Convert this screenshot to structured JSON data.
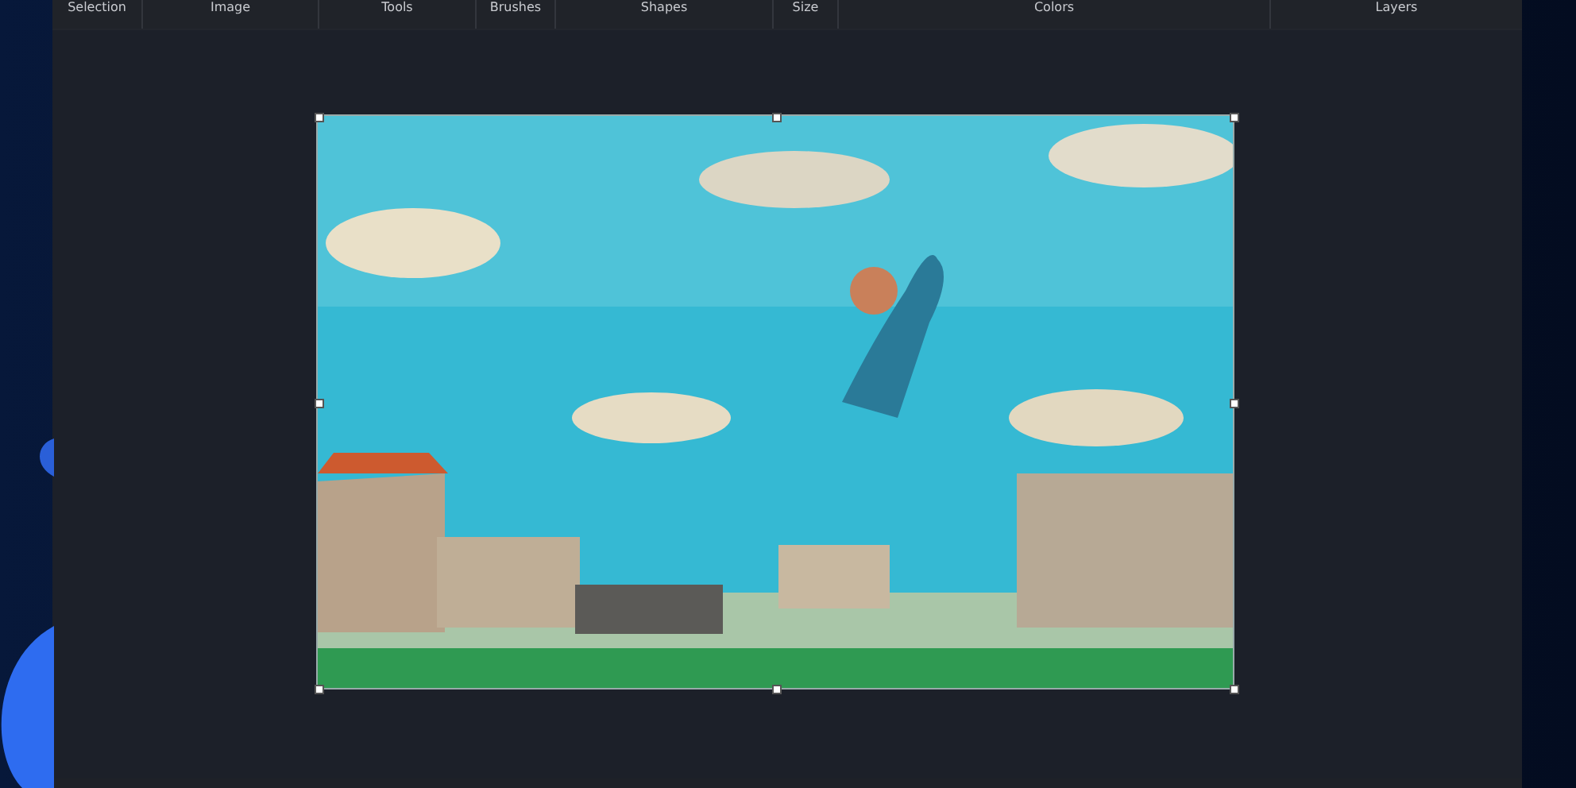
{
  "toolbar": {
    "groups": [
      {
        "label": "Selection"
      },
      {
        "label": "Image"
      },
      {
        "label": "Tools"
      },
      {
        "label": "Brushes"
      },
      {
        "label": "Shapes"
      },
      {
        "label": "Size"
      },
      {
        "label": "Colors"
      },
      {
        "label": "Layers"
      }
    ]
  }
}
